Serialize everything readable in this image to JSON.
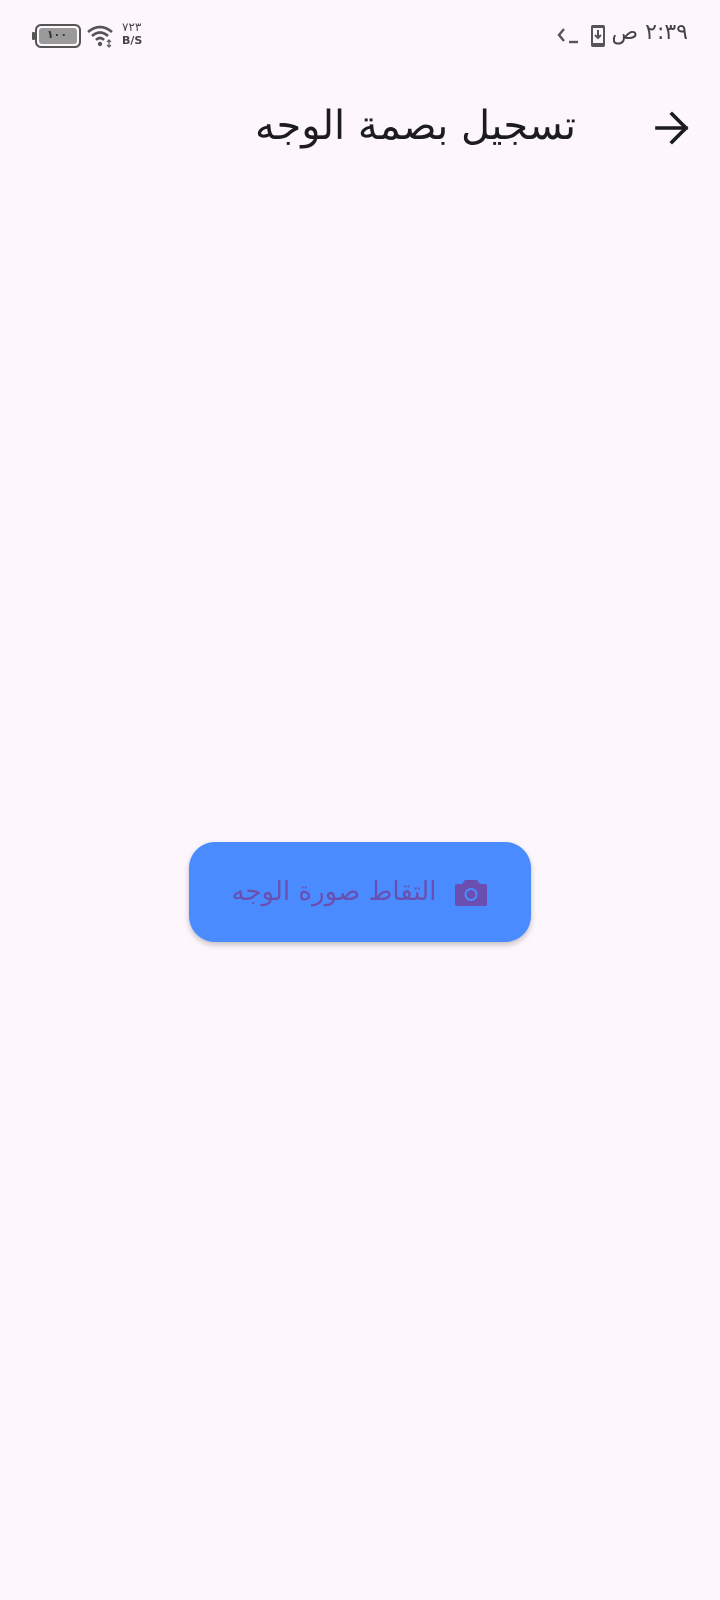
{
  "status_bar": {
    "time": "٢:٣٩ ص",
    "battery": "١٠٠",
    "net_speed_value": "٧٢٣",
    "net_speed_unit": "B/S",
    "icons": [
      "terminal-icon",
      "download-icon",
      "wifi-icon",
      "battery-icon"
    ]
  },
  "app_bar": {
    "title": "تسجيل بصمة الوجه",
    "back_icon": "arrow-right-icon"
  },
  "main": {
    "capture_button": {
      "label": "التقاط صورة الوجه",
      "icon": "camera-icon"
    }
  },
  "colors": {
    "background": "#fdf7fd",
    "button": "#4a8cff",
    "button_text": "#6a4fb0"
  }
}
